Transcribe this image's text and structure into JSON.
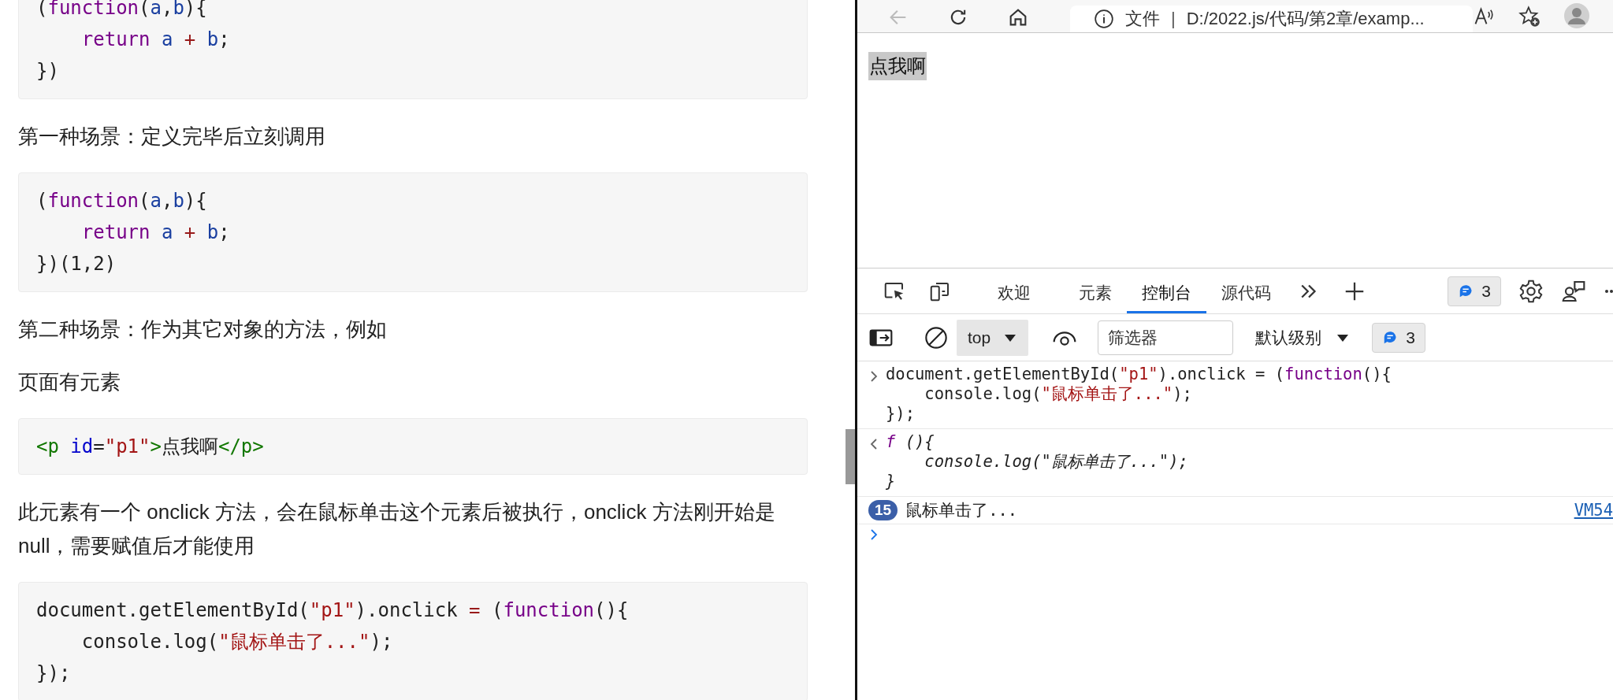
{
  "article": {
    "blocks": [
      {
        "kind": "code",
        "lines": [
          [
            {
              "text": "(",
              "kind": "plain"
            },
            {
              "text": "function",
              "kind": "keyword"
            },
            {
              "text": "(",
              "kind": "plain"
            },
            {
              "text": "a",
              "kind": "variable"
            },
            {
              "text": ",",
              "kind": "plain"
            },
            {
              "text": "b",
              "kind": "variable"
            },
            {
              "text": "){",
              "kind": "plain"
            }
          ],
          [
            {
              "text": "    return",
              "kind": "keyword"
            },
            {
              "text": " a",
              "kind": "variable"
            },
            {
              "text": " +",
              "kind": "operator"
            },
            {
              "text": " b",
              "kind": "variable"
            },
            {
              "text": ";",
              "kind": "plain"
            }
          ],
          [
            {
              "text": "})",
              "kind": "plain"
            }
          ]
        ]
      },
      {
        "kind": "paragraph",
        "text": "第一种场景：定义完毕后立刻调用"
      },
      {
        "kind": "code",
        "lines": [
          [
            {
              "text": "(",
              "kind": "plain"
            },
            {
              "text": "function",
              "kind": "keyword"
            },
            {
              "text": "(",
              "kind": "plain"
            },
            {
              "text": "a",
              "kind": "variable"
            },
            {
              "text": ",",
              "kind": "plain"
            },
            {
              "text": "b",
              "kind": "variable"
            },
            {
              "text": "){",
              "kind": "plain"
            }
          ],
          [
            {
              "text": "    return",
              "kind": "keyword"
            },
            {
              "text": " a",
              "kind": "variable"
            },
            {
              "text": " +",
              "kind": "operator"
            },
            {
              "text": " b",
              "kind": "variable"
            },
            {
              "text": ";",
              "kind": "plain"
            }
          ],
          [
            {
              "text": "})(1,2)",
              "kind": "plain"
            }
          ]
        ]
      },
      {
        "kind": "paragraph",
        "text": "第二种场景：作为其它对象的方法，例如"
      },
      {
        "kind": "paragraph",
        "text": "页面有元素"
      },
      {
        "kind": "code",
        "lines": [
          [
            {
              "text": "<p",
              "kind": "tag"
            },
            {
              "text": " id",
              "kind": "attribute"
            },
            {
              "text": "=",
              "kind": "plain"
            },
            {
              "text": "\"p1\"",
              "kind": "string"
            },
            {
              "text": ">",
              "kind": "tag"
            },
            {
              "text": "点我啊",
              "kind": "plain"
            },
            {
              "text": "</p>",
              "kind": "tag"
            }
          ]
        ]
      },
      {
        "kind": "paragraph",
        "text": "此元素有一个 onclick 方法，会在鼠标单击这个元素后被执行，onclick 方法刚开始是 null，需要赋值后才能使用"
      },
      {
        "kind": "code",
        "lines": [
          [
            {
              "text": "document.getElementById(",
              "kind": "plain"
            },
            {
              "text": "\"p1\"",
              "kind": "string"
            },
            {
              "text": ").onclick ",
              "kind": "plain"
            },
            {
              "text": "=",
              "kind": "operator"
            },
            {
              "text": " (",
              "kind": "plain"
            },
            {
              "text": "function",
              "kind": "keyword"
            },
            {
              "text": "(){",
              "kind": "plain"
            }
          ],
          [
            {
              "text": "    console.log(",
              "kind": "plain"
            },
            {
              "text": "\"鼠标单击了...\"",
              "kind": "string"
            },
            {
              "text": ");",
              "kind": "plain"
            }
          ],
          [
            {
              "text": "});",
              "kind": "plain"
            }
          ]
        ]
      }
    ]
  },
  "browser": {
    "nav_buttons": [
      {
        "kind": "back",
        "disabled": true
      },
      {
        "kind": "refresh",
        "disabled": false
      },
      {
        "kind": "home",
        "disabled": false
      }
    ],
    "address": {
      "scheme_label": "文件",
      "separator": "|",
      "url": "D:/2022.js/代码/第2章/examp..."
    },
    "page": {
      "text": "点我啊",
      "highlighted": true
    }
  },
  "devtools": {
    "tabs": [
      {
        "label": "欢迎",
        "selected": false
      },
      {
        "label": "元素",
        "selected": false
      },
      {
        "label": "控制台",
        "selected": true
      },
      {
        "label": "源代码",
        "selected": false
      }
    ],
    "issues_count": "3",
    "toolbar": {
      "context": "top",
      "filter_placeholder": "筛选器",
      "level": "默认级别",
      "issues_count": "3"
    },
    "console": [
      {
        "kind": "input",
        "lines": [
          [
            {
              "text": "document.getElementById(",
              "kind": "plain"
            },
            {
              "text": "\"p1\"",
              "kind": "string"
            },
            {
              "text": ").onclick = (",
              "kind": "plain"
            },
            {
              "text": "function",
              "kind": "keyword"
            },
            {
              "text": "(){",
              "kind": "plain"
            }
          ],
          [
            {
              "text": "    console.log(",
              "kind": "plain"
            },
            {
              "text": "\"鼠标单击了...\"",
              "kind": "string"
            },
            {
              "text": ");",
              "kind": "plain"
            }
          ],
          [
            {
              "text": "});",
              "kind": "plain"
            }
          ]
        ]
      },
      {
        "kind": "output",
        "lines": [
          [
            {
              "text": "f",
              "kind": "keyword"
            },
            {
              "text": " (){",
              "kind": "plain"
            }
          ],
          [
            {
              "text": "    console.log(\"鼠标单击了...\");",
              "kind": "plain"
            }
          ],
          [
            {
              "text": "}",
              "kind": "plain"
            }
          ]
        ]
      },
      {
        "kind": "log",
        "count": "15",
        "message": "鼠标单击了...",
        "source": "VM54"
      },
      {
        "kind": "prompt"
      }
    ]
  }
}
